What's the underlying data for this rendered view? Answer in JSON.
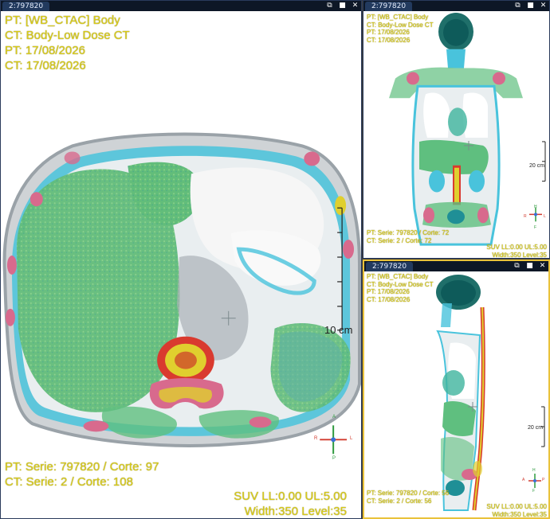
{
  "panels": {
    "main": {
      "tab": "2:797820",
      "info_top": [
        "PT: [WB_CTAC] Body",
        "CT: Body-Low Dose CT",
        "PT: 17/08/2026",
        "CT: 17/08/2026"
      ],
      "info_bottom_left": [
        "PT: Serie: 797820 / Corte: 97",
        "CT: Serie: 2 / Corte: 108"
      ],
      "info_bottom_right": [
        "SUV LL:0.00 UL:5.00",
        "Width:350 Level:35"
      ],
      "scale_label": "10 cm",
      "orientation": {
        "top": "A",
        "bottom": "P",
        "left": "R",
        "right": "L"
      }
    },
    "coronal": {
      "tab": "2:797820",
      "info_top": [
        "PT: [WB_CTAC] Body",
        "CT: Body-Low Dose CT",
        "PT: 17/08/2026",
        "CT: 17/08/2026"
      ],
      "info_bottom_left": [
        "PT: Serie: 797820 / Corte: 72",
        "CT: Serie: 2 / Corte: 72"
      ],
      "info_bottom_right": [
        "SUV LL:0.00 UL:5.00",
        "Width:350 Level:35"
      ],
      "scale_label": "20 cm",
      "orientation": {
        "top": "H",
        "bottom": "F",
        "left": "R",
        "right": "L"
      }
    },
    "sagittal": {
      "tab": "2:797820",
      "info_top": [
        "PT: [WB_CTAC] Body",
        "CT: Body-Low Dose CT",
        "PT: 17/08/2026",
        "CT: 17/08/2026"
      ],
      "info_bottom_left": [
        "PT: Serie: 797820 / Corte: 56",
        "CT: Serie: 2 / Corte: 56"
      ],
      "info_bottom_right": [
        "SUV LL:0.00 UL:5.00",
        "Width:350 Level:35"
      ],
      "scale_label": "20 cm",
      "orientation": {
        "top": "H",
        "bottom": "F",
        "left": "A",
        "right": "P"
      }
    }
  },
  "window_buttons": [
    "⧉",
    "■",
    "✕"
  ],
  "colors": {
    "overlay_text": "#d9cb18",
    "active_border": "#e9c23a",
    "pet_green": "#5fbf7f",
    "pet_cyan": "#3fc8e6",
    "pet_red": "#d8332e",
    "pet_yellow": "#e8d52a"
  }
}
